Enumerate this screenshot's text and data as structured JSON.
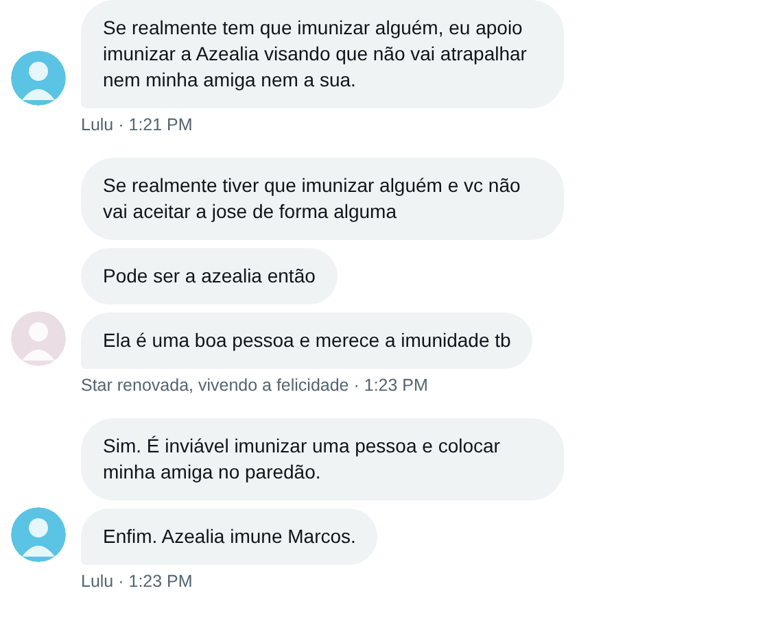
{
  "groups": [
    {
      "sender": "Lulu",
      "separator": "·",
      "time": "1:21 PM",
      "color": "#5bc3e3",
      "messages": [
        "Se realmente tem que imunizar alguém, eu apoio imunizar a Azealia visando que não vai atrapalhar nem minha amiga nem a sua."
      ]
    },
    {
      "sender": "Star renovada, vivendo a felicidade",
      "separator": "·",
      "time": "1:23 PM",
      "color": "#eadde3",
      "messages": [
        "Se realmente tiver que imunizar alguém e vc não vai aceitar a jose de forma alguma",
        "Pode ser a azealia então",
        "Ela é uma boa pessoa e merece a imunidade tb"
      ]
    },
    {
      "sender": "Lulu",
      "separator": "·",
      "time": "1:23 PM",
      "color": "#5bc3e3",
      "messages": [
        "Sim. É inviável imunizar uma pessoa e colocar minha amiga no paredão.",
        "Enfim. Azealia imune Marcos."
      ]
    }
  ]
}
